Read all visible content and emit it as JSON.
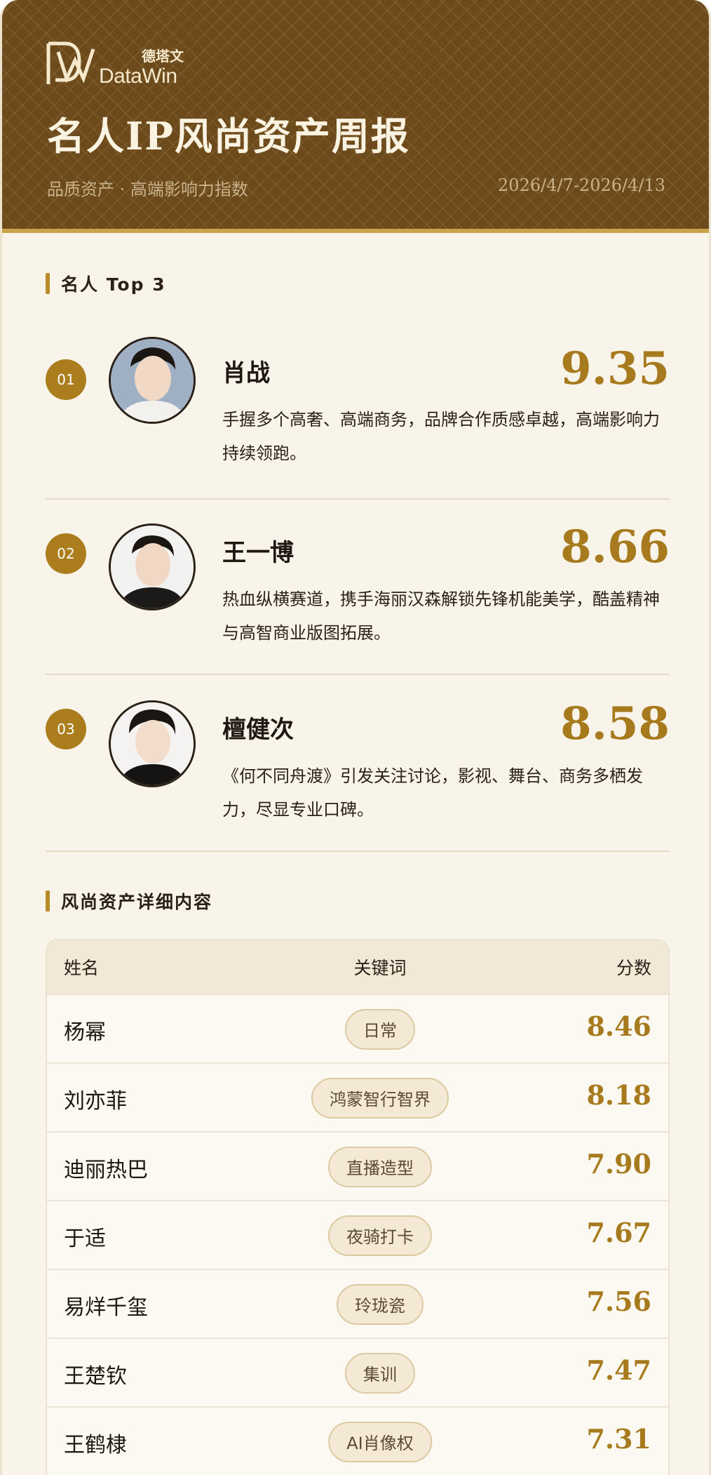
{
  "header": {
    "logo_cn": "德塔文",
    "logo_en": "DataWin",
    "title": "名人IP风尚资产周报",
    "subtitle": "品质资产 · 高端影响力指数",
    "date_range": "2026/4/7-2026/4/13"
  },
  "top3": {
    "section_title": "名人 Top 3",
    "items": [
      {
        "rank": "01",
        "name": "肖战",
        "score": "9.35",
        "desc": "手握多个高奢、高端商务，品牌合作质感卓越，高端影响力持续领跑。"
      },
      {
        "rank": "02",
        "name": "王一博",
        "score": "8.66",
        "desc": "热血纵横赛道，携手海丽汉森解锁先锋机能美学，酷盖精神与高智商业版图拓展。"
      },
      {
        "rank": "03",
        "name": "檀健次",
        "score": "8.58",
        "desc": "《何不同舟渡》引发关注讨论，影视、舞台、商务多栖发力，尽显专业口碑。"
      }
    ]
  },
  "details": {
    "section_title": "风尚资产详细内容",
    "headers": {
      "name": "姓名",
      "keyword": "关键词",
      "score": "分数"
    },
    "rows": [
      {
        "name": "杨幂",
        "keyword": "日常",
        "score": "8.46"
      },
      {
        "name": "刘亦菲",
        "keyword": "鸿蒙智行智界",
        "score": "8.18"
      },
      {
        "name": "迪丽热巴",
        "keyword": "直播造型",
        "score": "7.90"
      },
      {
        "name": "于适",
        "keyword": "夜骑打卡",
        "score": "7.67"
      },
      {
        "name": "易烊千玺",
        "keyword": "玲珑瓷",
        "score": "7.56"
      },
      {
        "name": "王楚钦",
        "keyword": "集训",
        "score": "7.47"
      },
      {
        "name": "王鹤棣",
        "keyword": "AI肖像权",
        "score": "7.31"
      }
    ]
  },
  "colors": {
    "brown": "#6d4a1b",
    "gold": "#a87a1e",
    "cream": "#f8f4ea"
  }
}
